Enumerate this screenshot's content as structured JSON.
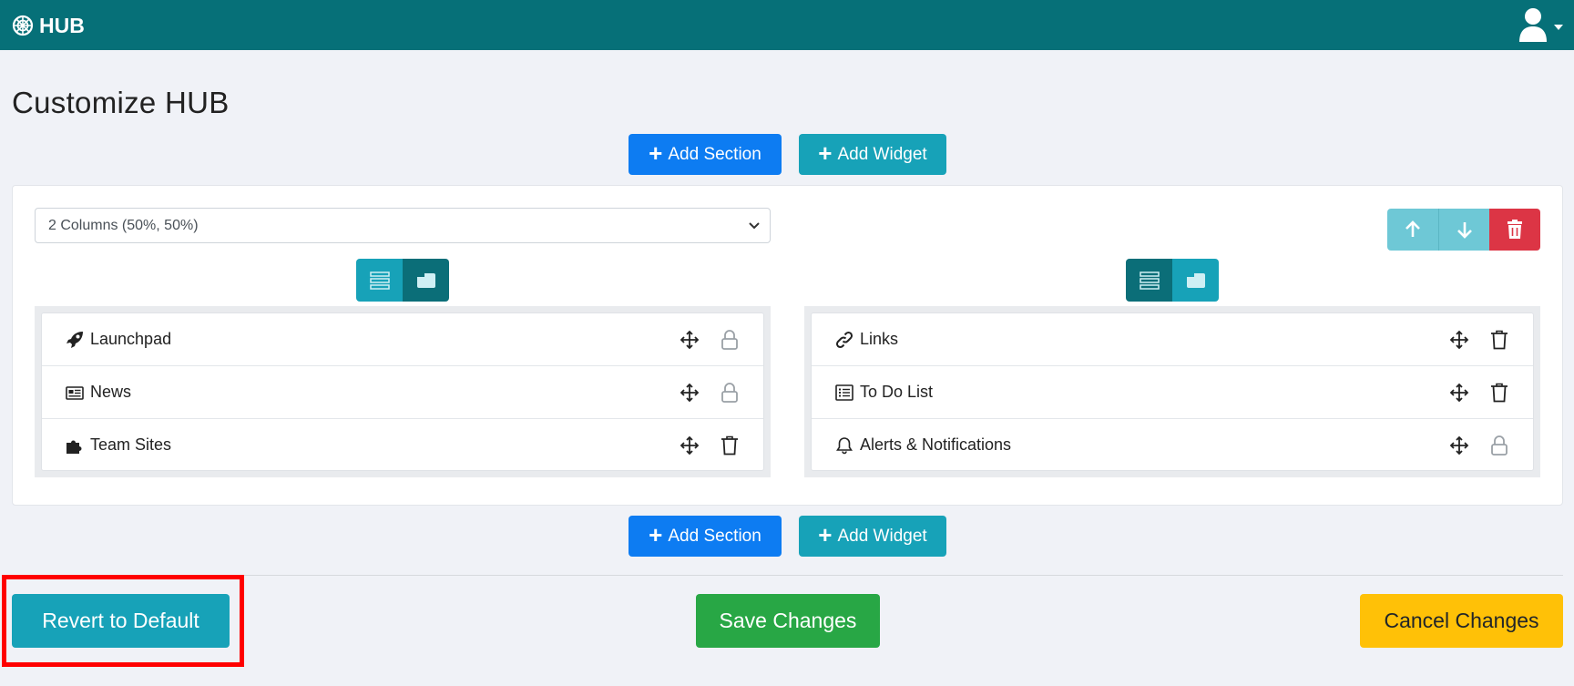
{
  "app": {
    "brand": "HUB"
  },
  "page": {
    "title": "Customize HUB"
  },
  "toolbar": {
    "add_section": "Add Section",
    "add_widget": "Add Widget"
  },
  "section": {
    "layout_select_value": "2 Columns (50%, 50%)",
    "columns": [
      {
        "active_view": "card",
        "widgets": [
          {
            "label": "Launchpad",
            "icon": "rocket-icon",
            "action": "lock-icon"
          },
          {
            "label": "News",
            "icon": "newspaper-icon",
            "action": "lock-icon"
          },
          {
            "label": "Team Sites",
            "icon": "puzzle-icon",
            "action": "trash-icon"
          }
        ]
      },
      {
        "active_view": "list",
        "widgets": [
          {
            "label": "Links",
            "icon": "link-icon",
            "action": "trash-icon"
          },
          {
            "label": "To Do List",
            "icon": "list-icon",
            "action": "trash-icon"
          },
          {
            "label": "Alerts & Notifications",
            "icon": "bell-icon",
            "action": "lock-icon"
          }
        ]
      }
    ]
  },
  "footer": {
    "revert": "Revert to Default",
    "save": "Save Changes",
    "cancel": "Cancel Changes"
  },
  "colors": {
    "header": "#067078",
    "primary": "#0d7cf2",
    "info": "#17a2b8",
    "success": "#28a745",
    "warning": "#ffc107",
    "danger": "#dc3545",
    "highlight": "#ff0000"
  }
}
